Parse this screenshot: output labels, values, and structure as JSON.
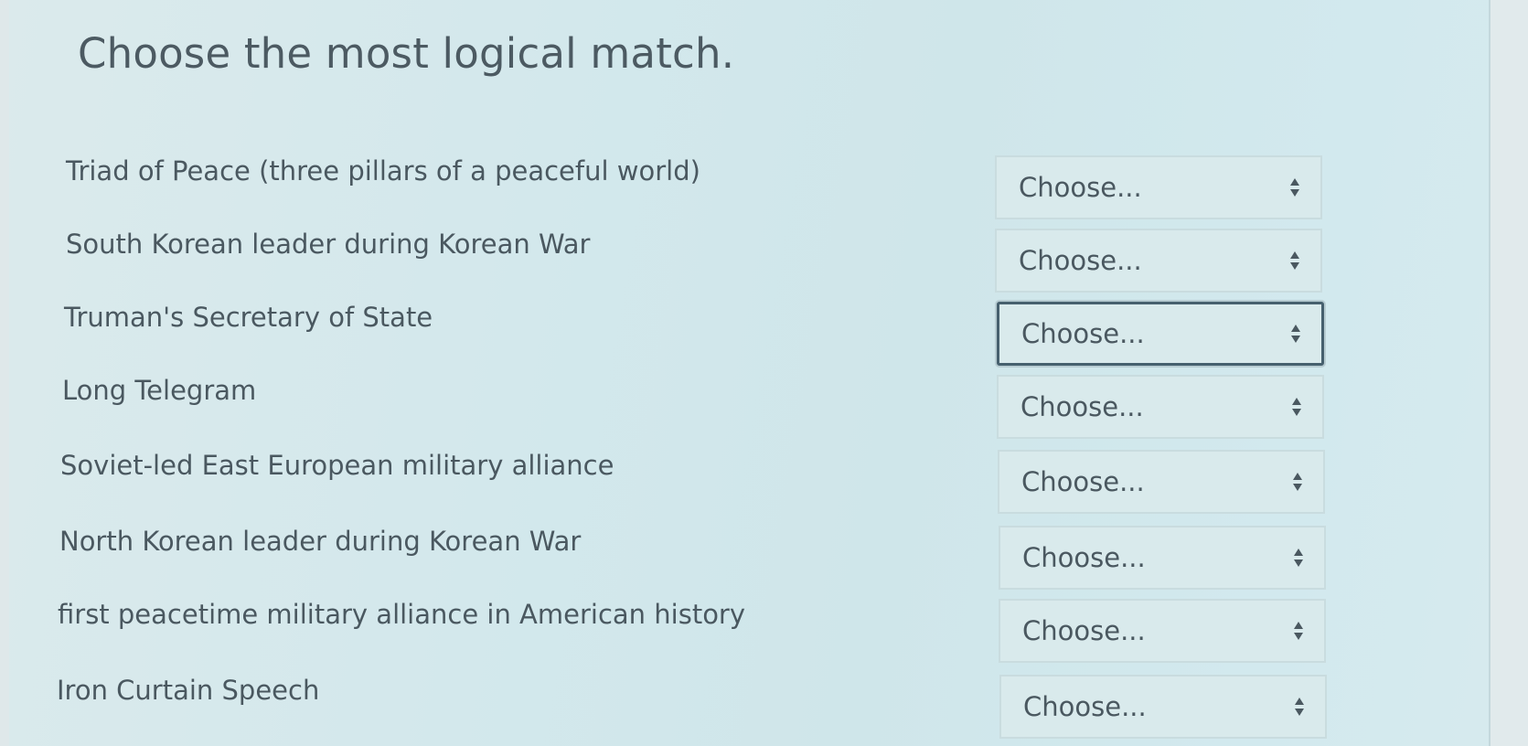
{
  "question": {
    "title": "Choose the most logical match."
  },
  "rows": [
    {
      "prompt": "Triad of Peace (three pillars of a peaceful world)",
      "selected": "Choose..."
    },
    {
      "prompt": "South Korean leader during Korean War",
      "selected": "Choose..."
    },
    {
      "prompt": "Truman's Secretary of State",
      "selected": "Choose..."
    },
    {
      "prompt": "Long Telegram",
      "selected": "Choose..."
    },
    {
      "prompt": "Soviet-led East European military alliance",
      "selected": "Choose..."
    },
    {
      "prompt": "North Korean leader during Korean War",
      "selected": "Choose..."
    },
    {
      "prompt": "first peacetime military alliance in American history",
      "selected": "Choose..."
    },
    {
      "prompt": "Iron Curtain Speech",
      "selected": "Choose..."
    }
  ],
  "icons": {
    "select_arrow": "up-down-arrows-icon"
  },
  "colors": {
    "background": "#d3e8ec",
    "text": "#4a5860",
    "focus_border": "#46606e"
  }
}
